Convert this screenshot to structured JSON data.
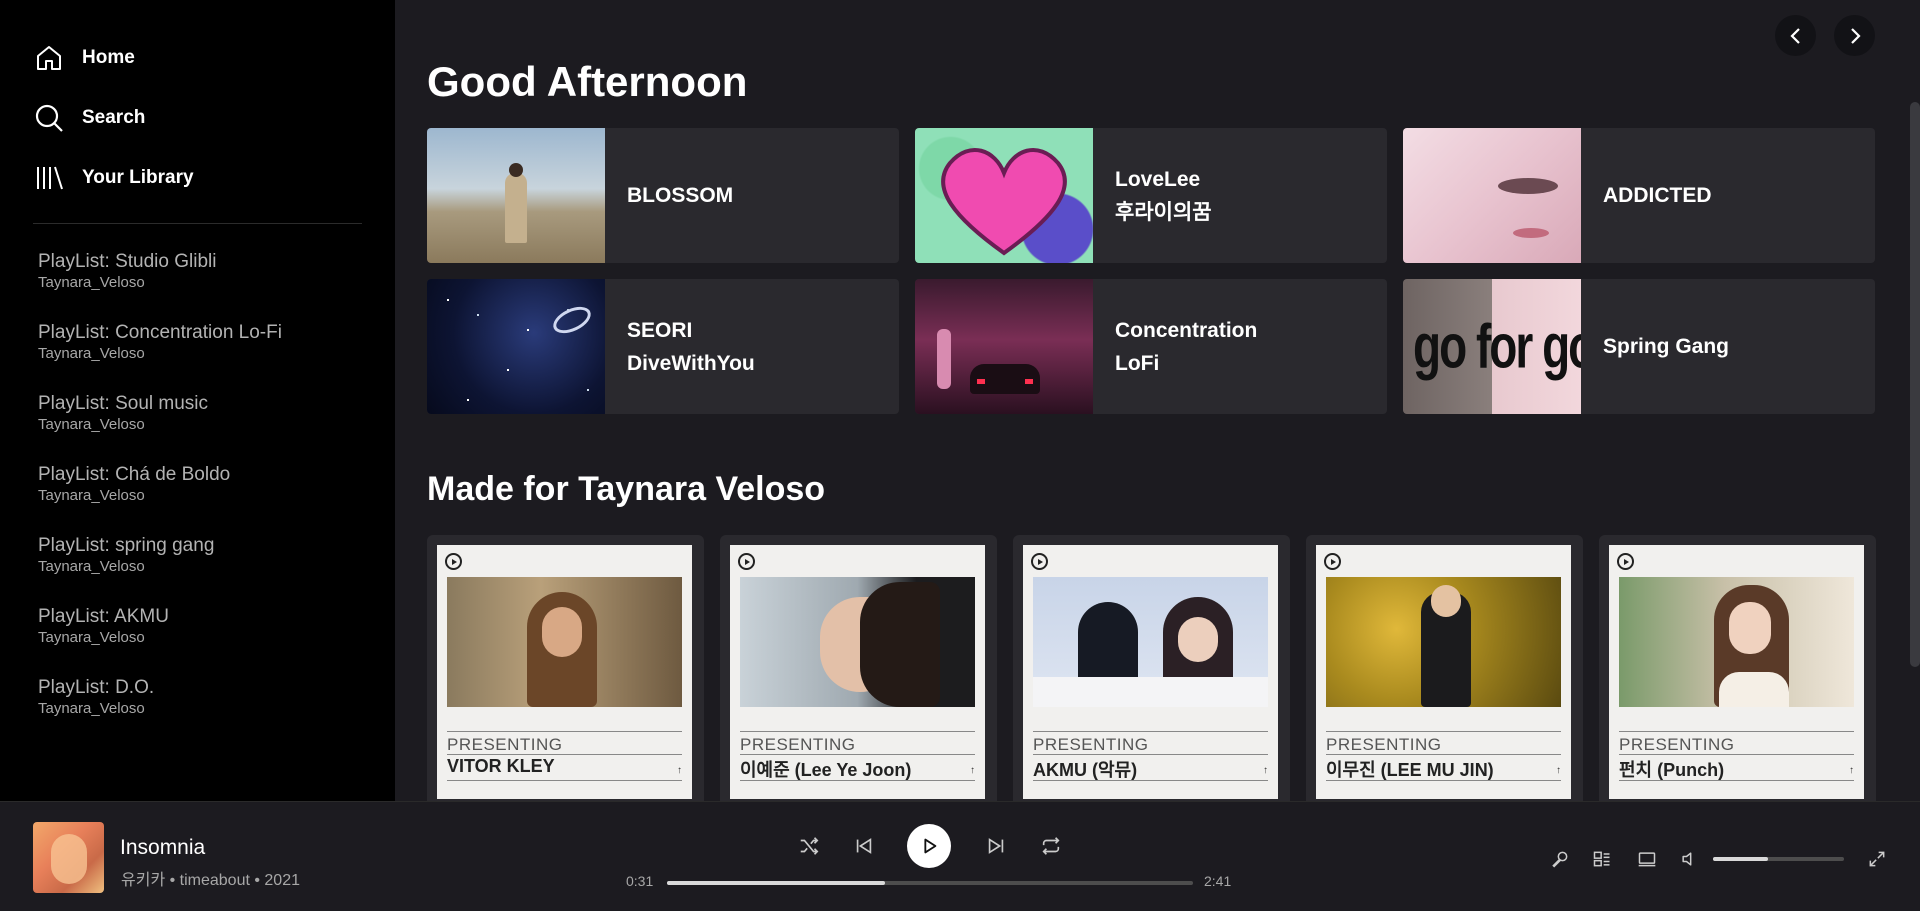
{
  "sidebar": {
    "nav": [
      {
        "label": "Home",
        "icon": "home-icon"
      },
      {
        "label": "Search",
        "icon": "search-icon"
      },
      {
        "label": "Your Library",
        "icon": "library-icon"
      }
    ],
    "playlists": [
      {
        "name": "PlayList: Studio Glibli",
        "owner": "Taynara_Veloso"
      },
      {
        "name": "PlayList: Concentration Lo-Fi",
        "owner": "Taynara_Veloso"
      },
      {
        "name": "PlayList: Soul music",
        "owner": "Taynara_Veloso"
      },
      {
        "name": "PlayList: Chá de Boldo",
        "owner": "Taynara_Veloso"
      },
      {
        "name": "PlayList: spring gang",
        "owner": "Taynara_Veloso"
      },
      {
        "name": "PlayList: AKMU",
        "owner": "Taynara_Veloso"
      },
      {
        "name": "PlayList: D.O.",
        "owner": "Taynara_Veloso"
      }
    ]
  },
  "main": {
    "greeting": "Good Afternoon",
    "quick_picks": [
      {
        "title": "BLOSSOM"
      },
      {
        "title": "LoveLee\n후라이의꿈"
      },
      {
        "title": "ADDICTED"
      },
      {
        "title": "SEORI\nDiveWithYou"
      },
      {
        "title": "Concentration\nLoFi"
      },
      {
        "title": "Spring Gang",
        "art_text": "go for gold"
      }
    ],
    "made_for_title": "Made for Taynara Veloso",
    "made_for": [
      {
        "presenting": "PRESENTING",
        "artist": "VITOR KLEY"
      },
      {
        "presenting": "PRESENTING",
        "artist": "이예준 (Lee Ye Joon)"
      },
      {
        "presenting": "PRESENTING",
        "artist": "AKMU (악뮤)"
      },
      {
        "presenting": "PRESENTING",
        "artist": "이무진 (LEE MU JIN)"
      },
      {
        "presenting": "PRESENTING",
        "artist": "펀치 (Punch)"
      }
    ]
  },
  "player": {
    "title": "Insomnia",
    "subtitle": "유키카 • timeabout • 2021",
    "elapsed": "0:31",
    "duration": "2:41",
    "progress_fraction": 0.415,
    "volume_fraction": 0.42
  },
  "colors": {
    "sidebar_bg": "#000000",
    "main_bg": "#1c1b20",
    "card_bg": "#2a292e",
    "text_primary": "#ffffff",
    "text_secondary": "#a7a7a7"
  }
}
